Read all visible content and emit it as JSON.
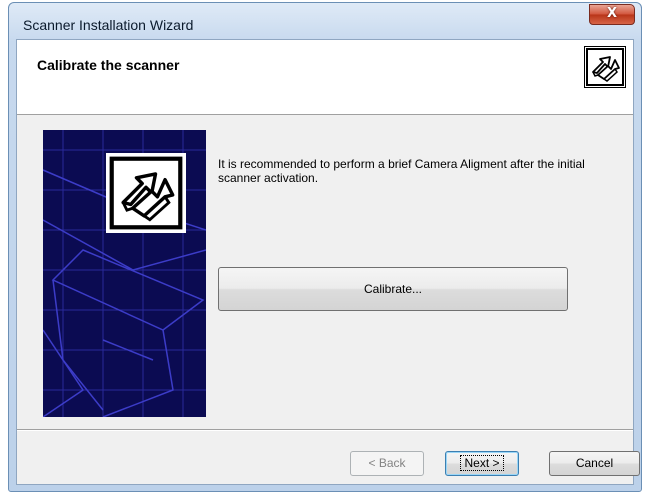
{
  "window": {
    "title": "Scanner Installation Wizard",
    "close_label": "X"
  },
  "header": {
    "title": "Calibrate the scanner",
    "logo_icon": "scanner-arrows-icon"
  },
  "side_panel": {
    "logo_icon": "scanner-arrows-icon",
    "background_color": "#0b0b52"
  },
  "content": {
    "description": "It is recommended to perform a brief Camera Aligment after the initial scanner activation.",
    "calibrate_label": "Calibrate..."
  },
  "footer": {
    "back_label": "< Back",
    "next_label": "Next >",
    "cancel_label": "Cancel"
  },
  "colors": {
    "title_bar": "#c7d9ee",
    "close_button": "#c74a2e",
    "default_button_border": "#3c7fb1"
  }
}
